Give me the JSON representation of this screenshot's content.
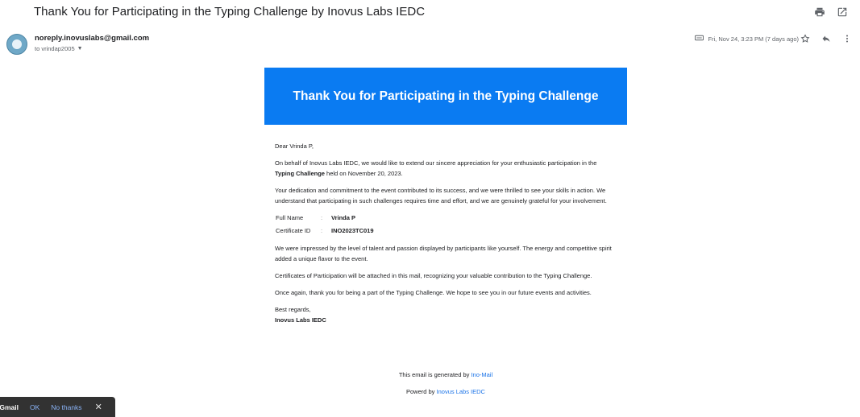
{
  "subject": "Thank You for Participating in the Typing Challenge by Inovus Labs IEDC",
  "toolbar": {
    "print_icon": "printer-icon",
    "popout_icon": "open-in-new-icon"
  },
  "sender": {
    "email": "noreply.inovuslabs@gmail.com",
    "to_line": "to vrindap2005"
  },
  "meta": {
    "date": "Fri, Nov 24, 3:23 PM (7 days ago)",
    "attachment_icon": "attachment-icon",
    "star_icon": "star-icon",
    "reply_icon": "reply-icon",
    "more_icon": "more-vert-icon"
  },
  "banner": {
    "title": "Thank You for Participating in the Typing Challenge",
    "color": "#0a7bf2"
  },
  "letter": {
    "greeting": "Dear Vrinda P,",
    "p1_pre": "On behalf of Inovus Labs IEDC, we would like to extend our sincere appreciation for your enthusiastic participation in the ",
    "p1_bold": "Typing Challenge",
    "p1_post": " held on November 20, 2023.",
    "p2": "Your dedication and commitment to the event contributed to its success, and we were thrilled to see your skills in action. We understand that participating in such challenges requires time and effort, and we are genuinely grateful for your involvement.",
    "details": [
      {
        "label": "Full Name",
        "sep": ":",
        "value": "Vrinda P"
      },
      {
        "label": "Certificate ID",
        "sep": ":",
        "value": "INO2023TC019"
      }
    ],
    "p3": "We were impressed by the level of talent and passion displayed by participants like yourself. The energy and competitive spirit added a unique flavor to the event.",
    "p4": "Certificates of Participation will be attached in this mail, recognizing your valuable contribution to the Typing Challenge.",
    "p5": "Once again, thank you for being a part of the Typing Challenge. We hope to see you in our future events and activities.",
    "closing": "Best regards,",
    "signature": "Inovus Labs IEDC"
  },
  "footer": {
    "generated_pre": "This email is generated by ",
    "generated_link": "Ino-Mail",
    "powered_pre": "Powerd by ",
    "powered_link": "Inovus Labs IEDC"
  },
  "snackbar": {
    "text": "Gmail.",
    "ok": "OK",
    "no_thanks": "No thanks",
    "close": "✕"
  }
}
